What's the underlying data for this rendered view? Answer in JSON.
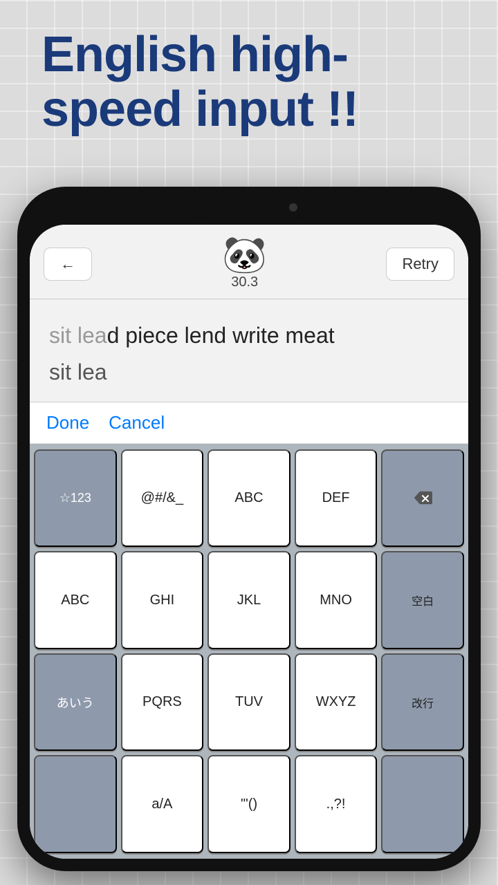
{
  "header": {
    "title": "English high-speed input !!"
  },
  "topBar": {
    "backLabel": "←",
    "retryLabel": "Retry",
    "score": "30.3",
    "pandaEmoji": "🐼"
  },
  "textDisplay": {
    "targetText": "sit lead piece lend write meat",
    "typedPart": "sit lea",
    "remainPart": "d piece lend write meat",
    "inputText": "sit lea"
  },
  "actionBar": {
    "doneLabel": "Done",
    "cancelLabel": "Cancel"
  },
  "keyboard": {
    "row1": [
      "☆123",
      "@#/&_",
      "ABC",
      "DEF",
      "⌫"
    ],
    "row2": [
      "ABC",
      "GHI",
      "JKL",
      "MNO",
      "空白"
    ],
    "row3a": [
      "",
      "PQRS",
      "TUV",
      "WXYZ",
      ""
    ],
    "row3b": [
      "あいう",
      "a/A",
      "'\"()",
      ".,?!",
      "改行"
    ],
    "kiguLabel": "☆123",
    "symbolLabel": "@#/&_",
    "abcLabel": "ABC",
    "defLabel": "DEF",
    "deleteLabel": "⌫",
    "abc2Label": "ABC",
    "ghiLabel": "GHI",
    "jklLabel": "JKL",
    "mnoLabel": "MNO",
    "spaceLabel": "空白",
    "pqrsLabel": "PQRS",
    "tuvLabel": "TUV",
    "wxyzLabel": "WXYZ",
    "aiuLabel": "あいう",
    "capsLabel": "a/A",
    "quoteLabel": "'\"()",
    "punctLabel": ".,?!",
    "enterLabel": "改行"
  }
}
